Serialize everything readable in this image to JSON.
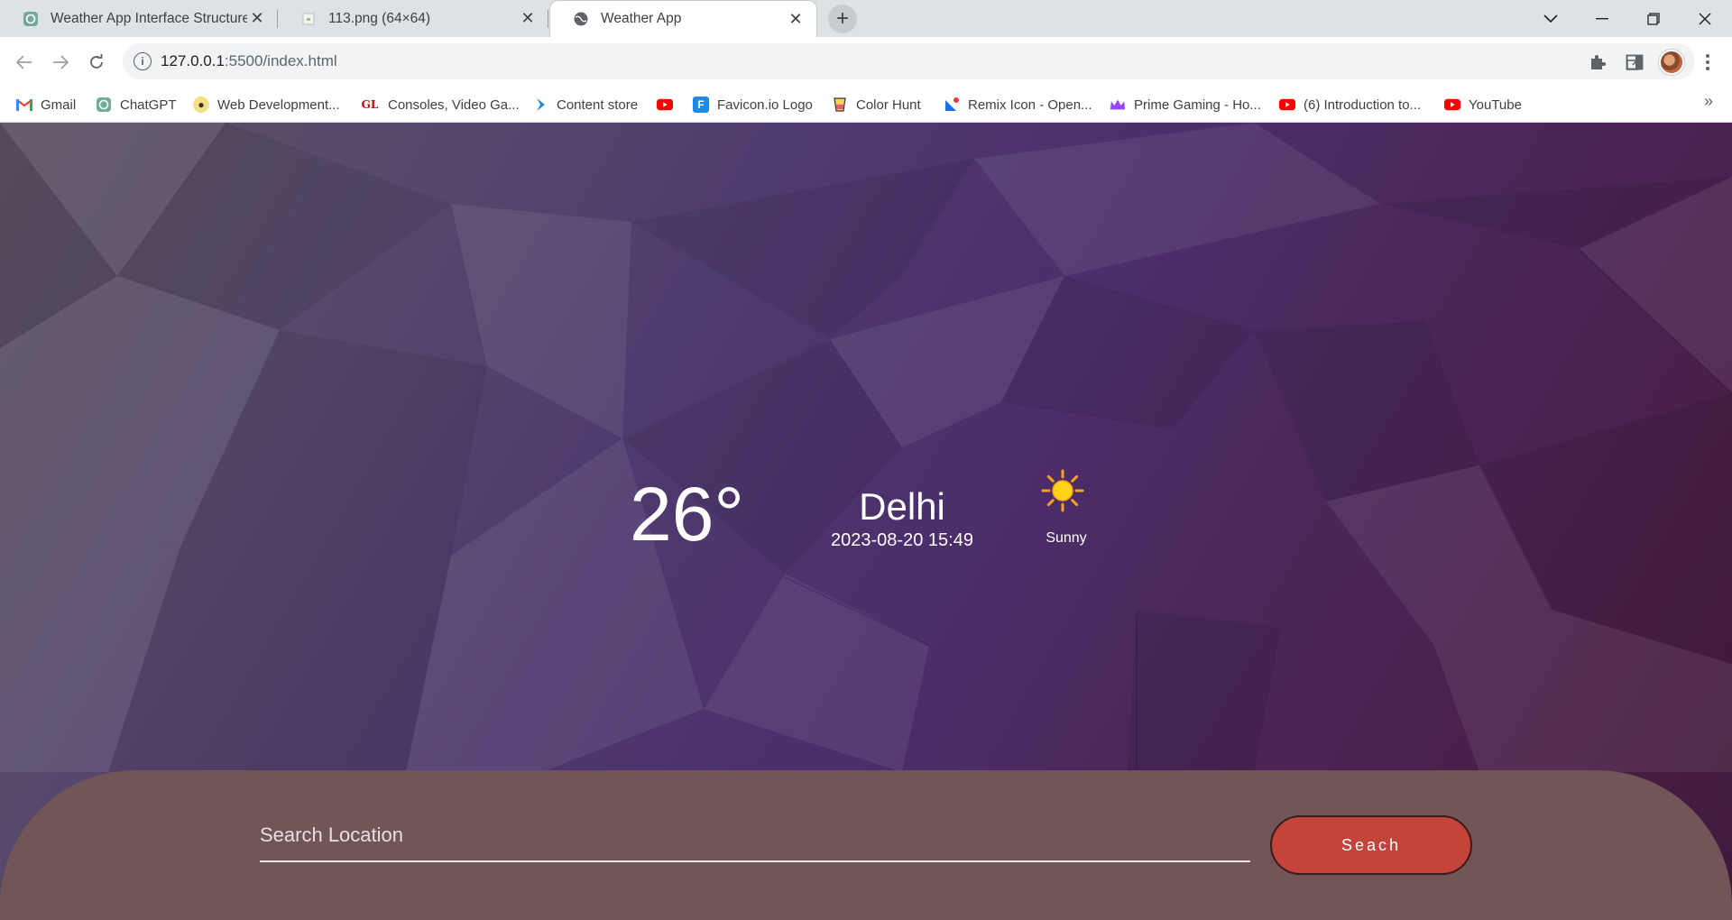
{
  "browser": {
    "tabs": [
      {
        "title": "Weather App Interface Structure",
        "active": false
      },
      {
        "title": "113.png (64×64)",
        "active": false
      },
      {
        "title": "Weather App",
        "active": true
      }
    ],
    "url": {
      "host": "127.0.0.1",
      "rest": ":5500/index.html"
    },
    "bookmarks": [
      "Gmail",
      "ChatGPT",
      "Web Development...",
      "Consoles, Video Ga...",
      "Content store",
      "",
      "Favicon.io Logo",
      "Color Hunt",
      "Remix Icon - Open...",
      "Prime Gaming - Ho...",
      "(6) Introduction to...",
      "YouTube"
    ],
    "bookmark_icons": [
      "gmail-icon",
      "chatgpt-icon",
      "webdev-icon",
      "gl-icon",
      "content-store-icon",
      "youtube-icon",
      "favicon-io-icon",
      "color-hunt-icon",
      "remix-icon",
      "prime-gaming-icon",
      "youtube-icon",
      "youtube-icon"
    ]
  },
  "weather": {
    "temperature": "26°",
    "city": "Delhi",
    "datetime": "2023-08-20 15:49",
    "condition": "Sunny",
    "condition_icon": "sun-icon"
  },
  "search": {
    "placeholder": "Search Location",
    "button_label": "Seach"
  },
  "colors": {
    "search_panel": "#725657",
    "search_button": "#c4443b",
    "background_top_left": "#5b5060",
    "background_bottom_right": "#3f1a3b"
  }
}
